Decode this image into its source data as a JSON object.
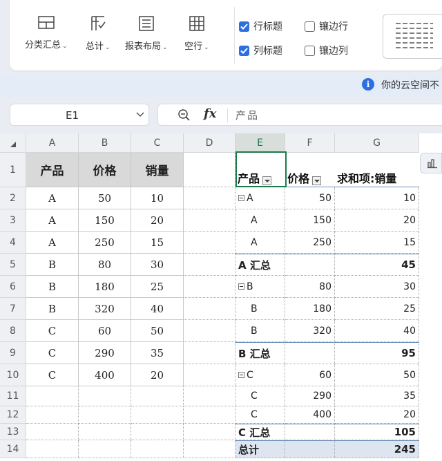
{
  "ribbon": {
    "subtotals_label": "分类汇总",
    "grand_totals_label": "总计",
    "report_layout_label": "报表布局",
    "blank_rows_label": "空行",
    "row_headers_label": "行标题",
    "row_headers_checked": true,
    "column_headers_label": "列标题",
    "column_headers_checked": true,
    "banded_rows_label": "镶边行",
    "banded_rows_checked": false,
    "banded_columns_label": "镶边列",
    "banded_columns_checked": false,
    "accent_color": "#2d6fe0"
  },
  "info_bar": {
    "text": "你的云空间不"
  },
  "formula_bar": {
    "name_box": "E1",
    "fx_label": "fx",
    "content": "产品"
  },
  "sheet": {
    "columns": [
      "A",
      "B",
      "C",
      "D",
      "E",
      "F",
      "G"
    ],
    "rows": [
      "1",
      "2",
      "3",
      "4",
      "5",
      "6",
      "7",
      "8",
      "9",
      "10",
      "11",
      "12",
      "13",
      "14"
    ],
    "selected_column": "E",
    "source_headers": [
      "产品",
      "价格",
      "销量"
    ],
    "source_rows": [
      [
        "A",
        "50",
        "10"
      ],
      [
        "A",
        "150",
        "20"
      ],
      [
        "A",
        "250",
        "15"
      ],
      [
        "B",
        "80",
        "30"
      ],
      [
        "B",
        "180",
        "25"
      ],
      [
        "B",
        "320",
        "40"
      ],
      [
        "C",
        "60",
        "50"
      ],
      [
        "C",
        "290",
        "35"
      ],
      [
        "C",
        "400",
        "20"
      ]
    ],
    "pivot_headers": [
      "产品",
      "价格",
      "求和项:销量"
    ],
    "pivot_rows": [
      {
        "kind": "group",
        "label": "A",
        "price": "50",
        "qty": "10"
      },
      {
        "kind": "item",
        "label": "A",
        "price": "150",
        "qty": "20"
      },
      {
        "kind": "item",
        "label": "A",
        "price": "250",
        "qty": "15"
      },
      {
        "kind": "subtotal",
        "label": "A 汇总",
        "price": "",
        "qty": "45"
      },
      {
        "kind": "group",
        "label": "B",
        "price": "80",
        "qty": "30"
      },
      {
        "kind": "item",
        "label": "B",
        "price": "180",
        "qty": "25"
      },
      {
        "kind": "item",
        "label": "B",
        "price": "320",
        "qty": "40"
      },
      {
        "kind": "subtotal",
        "label": "B 汇总",
        "price": "",
        "qty": "95"
      },
      {
        "kind": "group",
        "label": "C",
        "price": "60",
        "qty": "50"
      },
      {
        "kind": "item",
        "label": "C",
        "price": "290",
        "qty": "35"
      },
      {
        "kind": "item",
        "label": "C",
        "price": "400",
        "qty": "20"
      },
      {
        "kind": "subtotal",
        "label": "C 汇总",
        "price": "",
        "qty": "105"
      },
      {
        "kind": "grand",
        "label": "总计",
        "price": "",
        "qty": "245"
      }
    ]
  }
}
